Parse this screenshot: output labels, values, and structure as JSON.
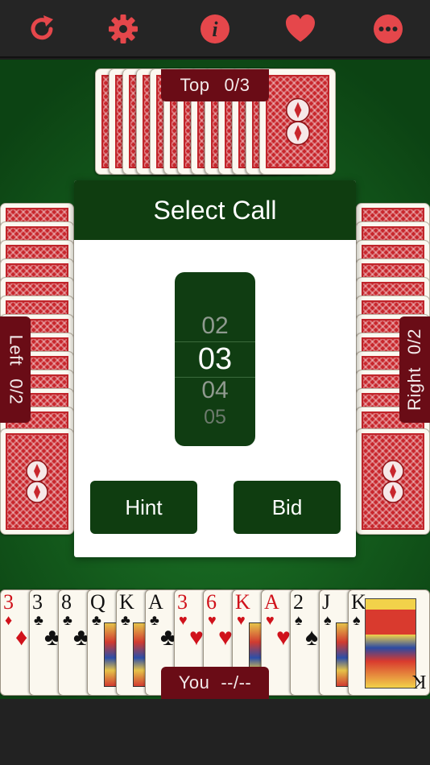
{
  "toolbar": {
    "buttons": [
      {
        "name": "refresh-icon",
        "glyph": "↻"
      },
      {
        "name": "gear-icon",
        "glyph": "⚙"
      },
      {
        "name": "info-icon",
        "glyph": "i"
      },
      {
        "name": "heart-icon",
        "glyph": "♥"
      },
      {
        "name": "more-icon",
        "glyph": "•••"
      }
    ],
    "icon_color": "#e5474b"
  },
  "seats": {
    "top": {
      "name": "Top",
      "score": "0/3"
    },
    "left": {
      "name": "Left",
      "score": "0/2"
    },
    "right": {
      "name": "Right",
      "score": "0/2"
    },
    "you": {
      "name": "You",
      "score": "--/--"
    }
  },
  "dialog": {
    "title": "Select Call",
    "picker_values": [
      "02",
      "03",
      "04",
      "05"
    ],
    "selected": "03",
    "hint_label": "Hint",
    "bid_label": "Bid"
  },
  "hand": [
    {
      "rank": "3",
      "suit": "♦",
      "color": "red"
    },
    {
      "rank": "3",
      "suit": "♣",
      "color": "black"
    },
    {
      "rank": "8",
      "suit": "♣",
      "color": "black"
    },
    {
      "rank": "Q",
      "suit": "♣",
      "color": "black"
    },
    {
      "rank": "K",
      "suit": "♣",
      "color": "black"
    },
    {
      "rank": "A",
      "suit": "♣",
      "color": "black"
    },
    {
      "rank": "3",
      "suit": "♥",
      "color": "red"
    },
    {
      "rank": "6",
      "suit": "♥",
      "color": "red"
    },
    {
      "rank": "K",
      "suit": "♥",
      "color": "red"
    },
    {
      "rank": "A",
      "suit": "♥",
      "color": "red"
    },
    {
      "rank": "2",
      "suit": "♠",
      "color": "black"
    },
    {
      "rank": "J",
      "suit": "♠",
      "color": "black"
    },
    {
      "rank": "K",
      "suit": "♠",
      "color": "black"
    }
  ],
  "colors": {
    "felt": "#16621f",
    "dialog_header": "#0f3d10",
    "seat_label": "#6a0c16",
    "card_back": "#c8262c"
  }
}
